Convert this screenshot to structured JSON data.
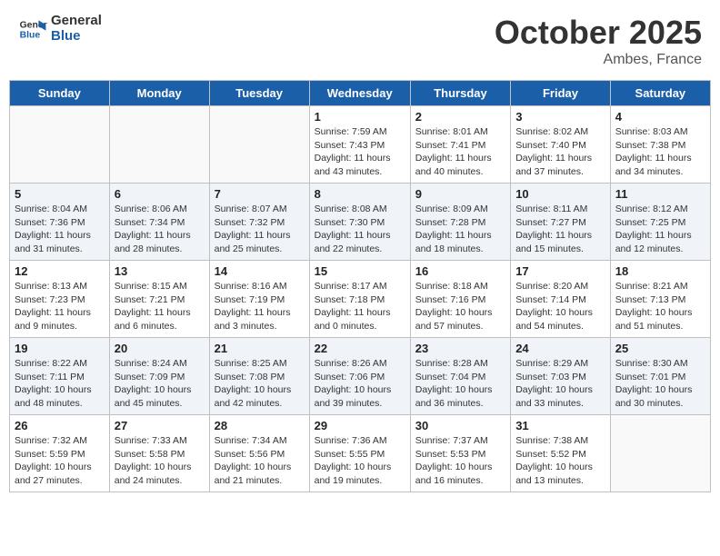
{
  "logo": {
    "line1": "General",
    "line2": "Blue"
  },
  "title": "October 2025",
  "location": "Ambes, France",
  "days_header": [
    "Sunday",
    "Monday",
    "Tuesday",
    "Wednesday",
    "Thursday",
    "Friday",
    "Saturday"
  ],
  "weeks": [
    [
      {
        "num": "",
        "info": ""
      },
      {
        "num": "",
        "info": ""
      },
      {
        "num": "",
        "info": ""
      },
      {
        "num": "1",
        "info": "Sunrise: 7:59 AM\nSunset: 7:43 PM\nDaylight: 11 hours\nand 43 minutes."
      },
      {
        "num": "2",
        "info": "Sunrise: 8:01 AM\nSunset: 7:41 PM\nDaylight: 11 hours\nand 40 minutes."
      },
      {
        "num": "3",
        "info": "Sunrise: 8:02 AM\nSunset: 7:40 PM\nDaylight: 11 hours\nand 37 minutes."
      },
      {
        "num": "4",
        "info": "Sunrise: 8:03 AM\nSunset: 7:38 PM\nDaylight: 11 hours\nand 34 minutes."
      }
    ],
    [
      {
        "num": "5",
        "info": "Sunrise: 8:04 AM\nSunset: 7:36 PM\nDaylight: 11 hours\nand 31 minutes."
      },
      {
        "num": "6",
        "info": "Sunrise: 8:06 AM\nSunset: 7:34 PM\nDaylight: 11 hours\nand 28 minutes."
      },
      {
        "num": "7",
        "info": "Sunrise: 8:07 AM\nSunset: 7:32 PM\nDaylight: 11 hours\nand 25 minutes."
      },
      {
        "num": "8",
        "info": "Sunrise: 8:08 AM\nSunset: 7:30 PM\nDaylight: 11 hours\nand 22 minutes."
      },
      {
        "num": "9",
        "info": "Sunrise: 8:09 AM\nSunset: 7:28 PM\nDaylight: 11 hours\nand 18 minutes."
      },
      {
        "num": "10",
        "info": "Sunrise: 8:11 AM\nSunset: 7:27 PM\nDaylight: 11 hours\nand 15 minutes."
      },
      {
        "num": "11",
        "info": "Sunrise: 8:12 AM\nSunset: 7:25 PM\nDaylight: 11 hours\nand 12 minutes."
      }
    ],
    [
      {
        "num": "12",
        "info": "Sunrise: 8:13 AM\nSunset: 7:23 PM\nDaylight: 11 hours\nand 9 minutes."
      },
      {
        "num": "13",
        "info": "Sunrise: 8:15 AM\nSunset: 7:21 PM\nDaylight: 11 hours\nand 6 minutes."
      },
      {
        "num": "14",
        "info": "Sunrise: 8:16 AM\nSunset: 7:19 PM\nDaylight: 11 hours\nand 3 minutes."
      },
      {
        "num": "15",
        "info": "Sunrise: 8:17 AM\nSunset: 7:18 PM\nDaylight: 11 hours\nand 0 minutes."
      },
      {
        "num": "16",
        "info": "Sunrise: 8:18 AM\nSunset: 7:16 PM\nDaylight: 10 hours\nand 57 minutes."
      },
      {
        "num": "17",
        "info": "Sunrise: 8:20 AM\nSunset: 7:14 PM\nDaylight: 10 hours\nand 54 minutes."
      },
      {
        "num": "18",
        "info": "Sunrise: 8:21 AM\nSunset: 7:13 PM\nDaylight: 10 hours\nand 51 minutes."
      }
    ],
    [
      {
        "num": "19",
        "info": "Sunrise: 8:22 AM\nSunset: 7:11 PM\nDaylight: 10 hours\nand 48 minutes."
      },
      {
        "num": "20",
        "info": "Sunrise: 8:24 AM\nSunset: 7:09 PM\nDaylight: 10 hours\nand 45 minutes."
      },
      {
        "num": "21",
        "info": "Sunrise: 8:25 AM\nSunset: 7:08 PM\nDaylight: 10 hours\nand 42 minutes."
      },
      {
        "num": "22",
        "info": "Sunrise: 8:26 AM\nSunset: 7:06 PM\nDaylight: 10 hours\nand 39 minutes."
      },
      {
        "num": "23",
        "info": "Sunrise: 8:28 AM\nSunset: 7:04 PM\nDaylight: 10 hours\nand 36 minutes."
      },
      {
        "num": "24",
        "info": "Sunrise: 8:29 AM\nSunset: 7:03 PM\nDaylight: 10 hours\nand 33 minutes."
      },
      {
        "num": "25",
        "info": "Sunrise: 8:30 AM\nSunset: 7:01 PM\nDaylight: 10 hours\nand 30 minutes."
      }
    ],
    [
      {
        "num": "26",
        "info": "Sunrise: 7:32 AM\nSunset: 5:59 PM\nDaylight: 10 hours\nand 27 minutes."
      },
      {
        "num": "27",
        "info": "Sunrise: 7:33 AM\nSunset: 5:58 PM\nDaylight: 10 hours\nand 24 minutes."
      },
      {
        "num": "28",
        "info": "Sunrise: 7:34 AM\nSunset: 5:56 PM\nDaylight: 10 hours\nand 21 minutes."
      },
      {
        "num": "29",
        "info": "Sunrise: 7:36 AM\nSunset: 5:55 PM\nDaylight: 10 hours\nand 19 minutes."
      },
      {
        "num": "30",
        "info": "Sunrise: 7:37 AM\nSunset: 5:53 PM\nDaylight: 10 hours\nand 16 minutes."
      },
      {
        "num": "31",
        "info": "Sunrise: 7:38 AM\nSunset: 5:52 PM\nDaylight: 10 hours\nand 13 minutes."
      },
      {
        "num": "",
        "info": ""
      }
    ]
  ]
}
